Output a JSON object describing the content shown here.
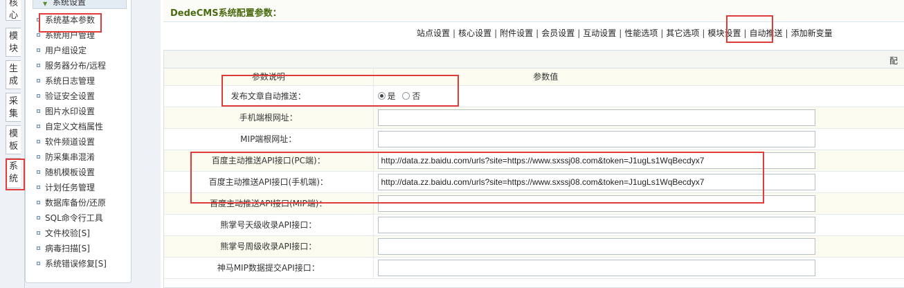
{
  "side_tabs": [
    "核心",
    "模块",
    "生成",
    "采集",
    "模板",
    "系统"
  ],
  "menu": {
    "heading": "系统设置",
    "items": [
      "系统基本参数",
      "系统用户管理",
      "用户组设定",
      "服务器分布/远程",
      "系统日志管理",
      "验证安全设置",
      "图片水印设置",
      "自定义文档属性",
      "软件频道设置",
      "防采集串混淆",
      "随机模板设置",
      "计划任务管理",
      "数据库备份/还原",
      "SQL命令行工具",
      "文件校验[S]",
      "病毒扫描[S]",
      "系统错误修复[S]"
    ]
  },
  "page_title": "DedeCMS系统配置参数：",
  "nav_links": [
    "站点设置",
    "核心设置",
    "附件设置",
    "会员设置",
    "互动设置",
    "性能选项",
    "其它选项",
    "模块设置",
    "自动推送",
    "添加新变量"
  ],
  "box_head": "配置",
  "table": {
    "col_param": "参数说明",
    "col_value": "参数值",
    "rows": [
      {
        "label": "发布文章自动推送：",
        "type": "radio",
        "options": [
          "是",
          "否"
        ],
        "selected": "是"
      },
      {
        "label": "手机端根网址：",
        "type": "text",
        "value": ""
      },
      {
        "label": "MIP端根网址：",
        "type": "text",
        "value": ""
      },
      {
        "label": "百度主动推送API接口(PC端)：",
        "type": "text",
        "value": "http://data.zz.baidu.com/urls?site=https://www.sxssj08.com&token=J1ugLs1WqBecdyx7"
      },
      {
        "label": "百度主动推送API接口(手机端)：",
        "type": "text",
        "value": "http://data.zz.baidu.com/urls?site=https://www.sxssj08.com&token=J1ugLs1WqBecdyx7"
      },
      {
        "label": "百度主动推送API接口(MIP端)：",
        "type": "text",
        "value": ""
      },
      {
        "label": "熊掌号天级收录API接口：",
        "type": "text",
        "value": ""
      },
      {
        "label": "熊掌号周级收录API接口：",
        "type": "text",
        "value": ""
      },
      {
        "label": "神马MIP数据提交API接口：",
        "type": "text",
        "value": ""
      }
    ]
  },
  "colors": {
    "annotation": "#e03a3a",
    "title": "#4a6a10"
  }
}
